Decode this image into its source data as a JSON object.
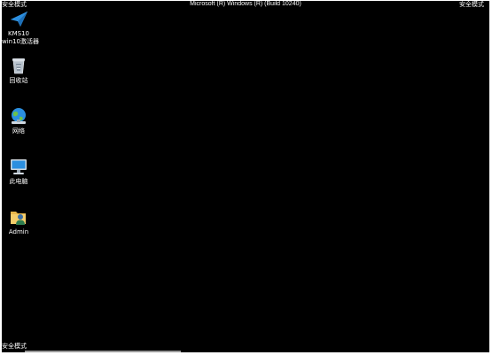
{
  "watermark": {
    "top_left": "安全模式",
    "top_right": "安全模式",
    "bottom_left": "安全模式",
    "center_title": "Microsoft (R) Windows (R) (Build 10240)"
  },
  "desktop_icons": [
    {
      "label_line1": "KMS10",
      "label_line2": "win10激活器",
      "icon": "paper-plane-icon"
    },
    {
      "label_line1": "回收站",
      "icon": "recycle-bin-icon"
    },
    {
      "label_line1": "网络",
      "icon": "network-globe-icon"
    },
    {
      "label_line1": "此电脑",
      "icon": "computer-monitor-icon"
    },
    {
      "label_line1": "Admin",
      "icon": "user-folder-icon"
    }
  ],
  "colors": {
    "background": "#000000",
    "text": "#ffffff",
    "accent_blue": "#2b8fe0"
  }
}
